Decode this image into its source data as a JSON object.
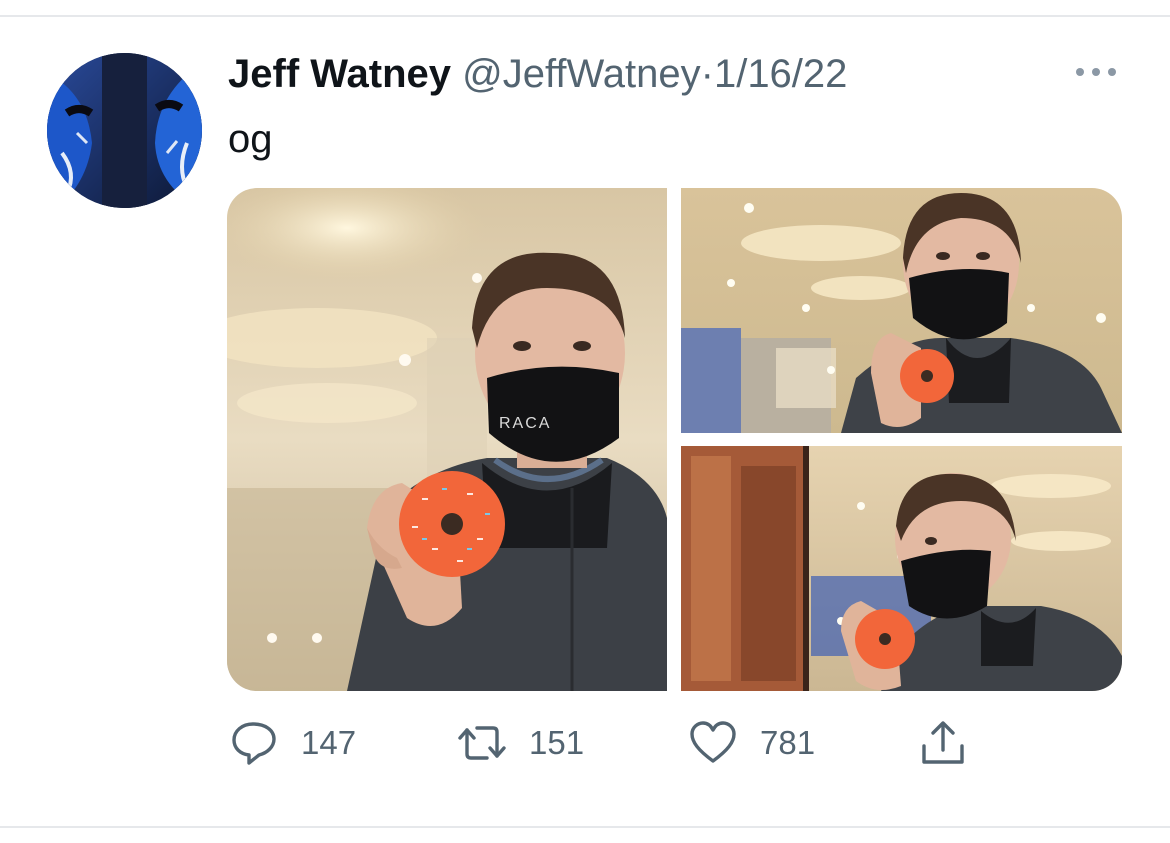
{
  "tweet": {
    "author_name": "Jeff Watney",
    "handle": "@JeffWatney",
    "separator": "·",
    "date": "1/16/22",
    "text": "og",
    "mask_text": "RACA"
  },
  "actions": {
    "replies": "147",
    "retweets": "151",
    "likes": "781"
  },
  "icons": {
    "more": "more-horizontal-icon",
    "reply": "reply-icon",
    "retweet": "retweet-icon",
    "like": "heart-icon",
    "share": "share-icon"
  },
  "colors": {
    "text": "#0f1419",
    "secondary": "#536471",
    "divider": "#e6e8eb"
  }
}
